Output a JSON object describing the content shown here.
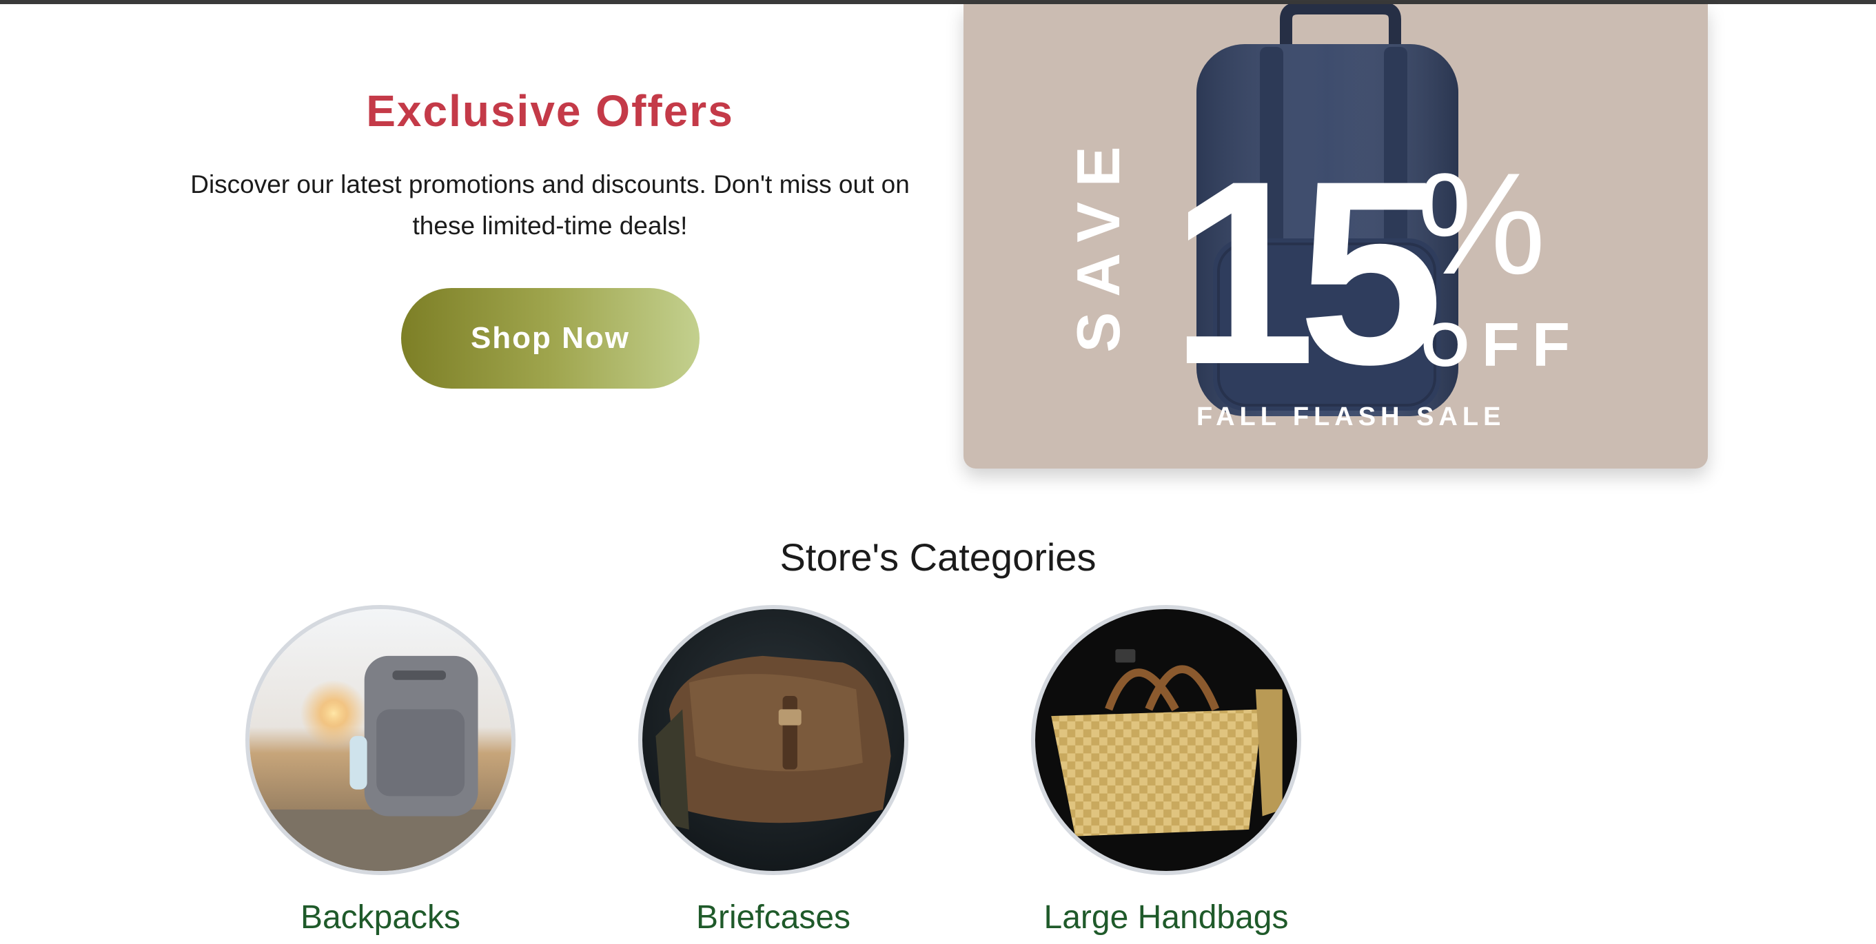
{
  "offers": {
    "title": "Exclusive Offers",
    "description": "Discover our latest promotions and discounts. Don't miss out on these limited-time deals!",
    "button_label": "Shop Now",
    "title_color": "#c43a48",
    "button_gradient": [
      "#7d7f26",
      "#c3d08e"
    ]
  },
  "promo_banner": {
    "save_text": "SAVE",
    "amount": "15",
    "percent_sign": "%",
    "off_text": "OFF",
    "subtitle": "FALL FLASH SALE",
    "background_color": "#cbbcb2",
    "image": "navy-backpack-photo"
  },
  "categories": {
    "title": "Store's Categories",
    "items": [
      {
        "label": "Backpacks",
        "image": "grey-backpack-photo"
      },
      {
        "label": "Briefcases",
        "image": "brown-leather-bag-photo"
      },
      {
        "label": "Large Handbags",
        "image": "woven-gold-tote-photo"
      }
    ],
    "label_color": "#1f5a2a"
  }
}
